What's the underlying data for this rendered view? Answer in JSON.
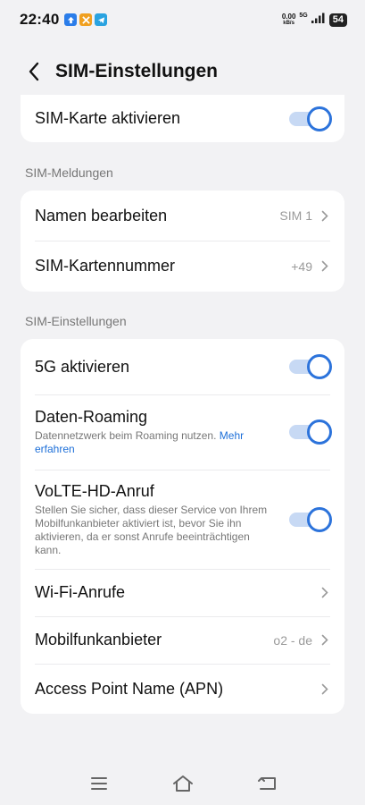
{
  "status_bar": {
    "time": "22:40",
    "notifications": [
      {
        "icon": "upload-icon",
        "color": "#2b7de9"
      },
      {
        "icon": "app-icon",
        "color": "#f0a020"
      },
      {
        "icon": "telegram-icon",
        "color": "#2aa3e0"
      }
    ],
    "speed_value": "0.00",
    "speed_unit": "kB/s",
    "network": "5G",
    "battery": "54"
  },
  "header": {
    "title": "SIM-Einstellungen"
  },
  "sim_card": {
    "activate_label": "SIM-Karte aktivieren",
    "activate_on": true
  },
  "messages_section": {
    "title": "SIM-Meldungen",
    "edit_name_label": "Namen bearbeiten",
    "edit_name_value": "SIM 1",
    "number_label": "SIM-Kartennummer",
    "number_value": "+49"
  },
  "settings_section": {
    "title": "SIM-Einstellungen",
    "fiveg_label": "5G aktivieren",
    "fiveg_on": true,
    "roaming_label": "Daten-Roaming",
    "roaming_desc": "Datennetzwerk beim Roaming nutzen.",
    "roaming_link": "Mehr erfahren",
    "roaming_on": true,
    "volte_label": "VoLTE-HD-Anruf",
    "volte_desc": "Stellen Sie sicher, dass dieser Service von Ihrem Mobilfunkanbieter aktiviert ist, bevor Sie ihn aktivieren, da er sonst Anrufe beeinträchtigen kann.",
    "volte_on": true,
    "wifi_calls_label": "Wi-Fi-Anrufe",
    "provider_label": "Mobilfunkanbieter",
    "provider_value": "o2 - de",
    "apn_label": "Access Point Name (APN)"
  },
  "colors": {
    "accent": "#2c73db",
    "toggle_track": "#c7d9f4",
    "link": "#1d6fd8",
    "background": "#f2f2f4"
  }
}
